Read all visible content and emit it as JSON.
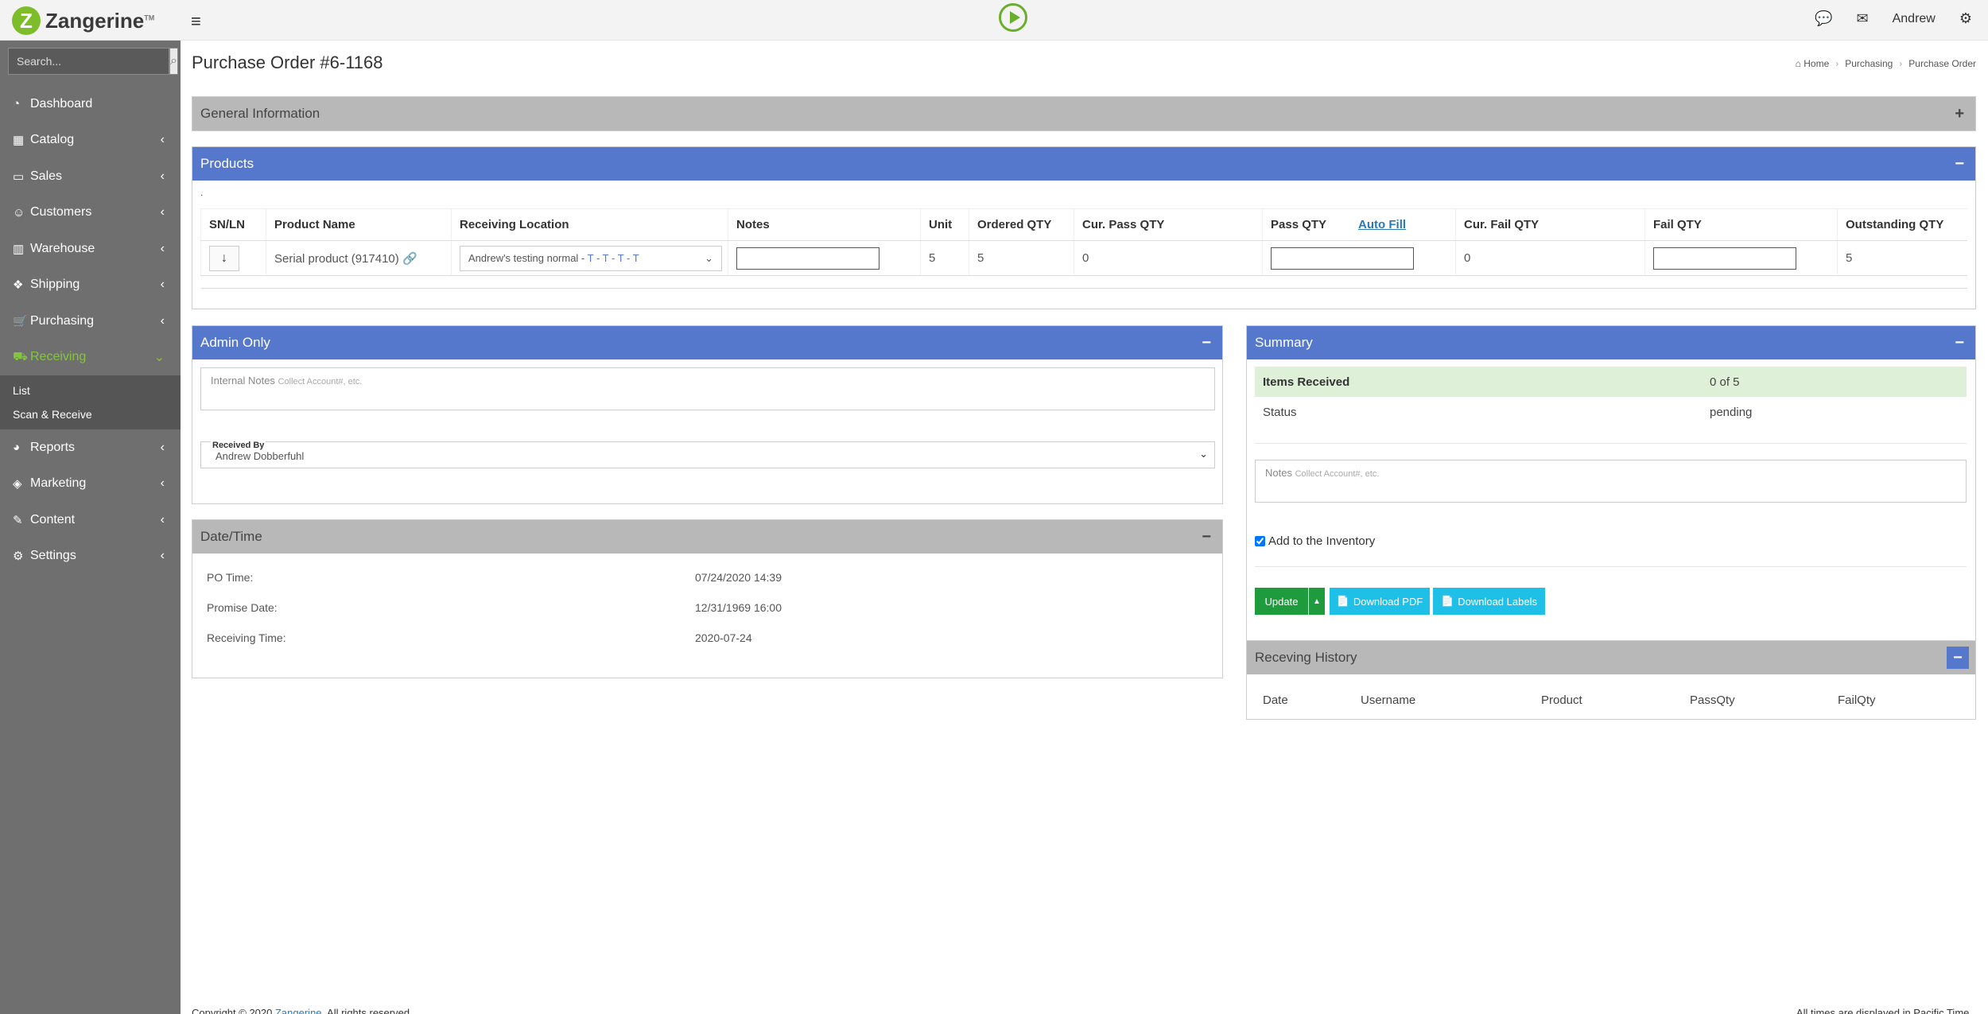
{
  "app": {
    "logo_letter": "Z",
    "logo_name": "Zangerine",
    "logo_tm": "TM"
  },
  "topbar": {
    "user_name": "Andrew"
  },
  "sidebar": {
    "search_placeholder": "Search...",
    "items": [
      {
        "label": "Dashboard",
        "icon": "dashboard-icon",
        "glyph": "◔"
      },
      {
        "label": "Catalog",
        "icon": "table-icon",
        "glyph": "▦"
      },
      {
        "label": "Sales",
        "icon": "credit-card-icon",
        "glyph": "▭"
      },
      {
        "label": "Customers",
        "icon": "users-icon",
        "glyph": "☺"
      },
      {
        "label": "Warehouse",
        "icon": "barcode-icon",
        "glyph": "▥"
      },
      {
        "label": "Shipping",
        "icon": "dropbox-icon",
        "glyph": "❖"
      },
      {
        "label": "Purchasing",
        "icon": "cart-icon",
        "glyph": "🛒"
      },
      {
        "label": "Receiving",
        "icon": "truck-icon",
        "glyph": "⛟"
      },
      {
        "label": "Reports",
        "icon": "pie-chart-icon",
        "glyph": "◕"
      },
      {
        "label": "Marketing",
        "icon": "tag-icon",
        "glyph": "◈"
      },
      {
        "label": "Content",
        "icon": "edit-icon",
        "glyph": "✎"
      },
      {
        "label": "Settings",
        "icon": "gear-icon",
        "glyph": "⚙"
      }
    ],
    "receiving_sub": [
      "List",
      "Scan & Receive"
    ]
  },
  "page": {
    "title": "Purchase Order #6-1168",
    "breadcrumb": [
      "Home",
      "Purchasing",
      "Purchase Order"
    ]
  },
  "general": {
    "title": "General Information",
    "toggle": "+"
  },
  "products": {
    "title": "Products",
    "toggle": "−",
    "dot": ".",
    "columns": [
      "SN/LN",
      "Product Name",
      "Receiving Location",
      "Notes",
      "Unit",
      "Ordered QTY",
      "Cur. Pass QTY",
      "Pass QTY",
      "Cur. Fail QTY",
      "Fail QTY",
      "Outstanding QTY"
    ],
    "autofill": "Auto Fill",
    "row": {
      "product_name": "Serial product (917410)",
      "location": "Andrew's testing normal - ",
      "location_suffix": "T - T - T - T",
      "unit": "5",
      "ordered": "5",
      "cur_pass": "0",
      "cur_fail": "0",
      "outstanding": "5"
    }
  },
  "admin": {
    "title": "Admin Only",
    "toggle": "−",
    "internal_notes": "Internal Notes",
    "internal_hint": "Collect Account#, etc.",
    "received_by_label": "Received By",
    "received_by_value": "Andrew Dobberfuhl"
  },
  "datetime": {
    "title": "Date/Time",
    "toggle": "−",
    "rows": [
      {
        "label": "PO Time:",
        "value": "07/24/2020 14:39"
      },
      {
        "label": "Promise Date:",
        "value": "12/31/1969 16:00"
      },
      {
        "label": "Receiving Time:",
        "value": "2020-07-24"
      }
    ]
  },
  "summary": {
    "title": "Summary",
    "toggle": "−",
    "items_received_label": "Items Received",
    "items_received_value": "0 of 5",
    "status_label": "Status",
    "status_value": "pending",
    "notes_label": "Notes",
    "notes_hint": "Collect Account#, etc.",
    "add_inventory": "Add to the Inventory",
    "update": "Update",
    "download_pdf": "Download PDF",
    "download_labels": "Download Labels"
  },
  "history": {
    "title": "Receving History",
    "toggle": "−",
    "columns": [
      "Date",
      "Username",
      "Product",
      "PassQty",
      "FailQty"
    ]
  },
  "footer": {
    "left_prefix": "Copyright © 2020 ",
    "left_link": "Zangerine",
    "left_suffix": ". All rights reserved.",
    "right": "All times are displayed in Pacific Time."
  },
  "colors": {
    "brand": "#7dbd2a",
    "panel_blue": "#5577cc",
    "panel_gray": "#b8b8b8",
    "sidebar": "#6f6f6f",
    "update_green": "#1e9b3c",
    "cyan": "#1fc0e8"
  }
}
